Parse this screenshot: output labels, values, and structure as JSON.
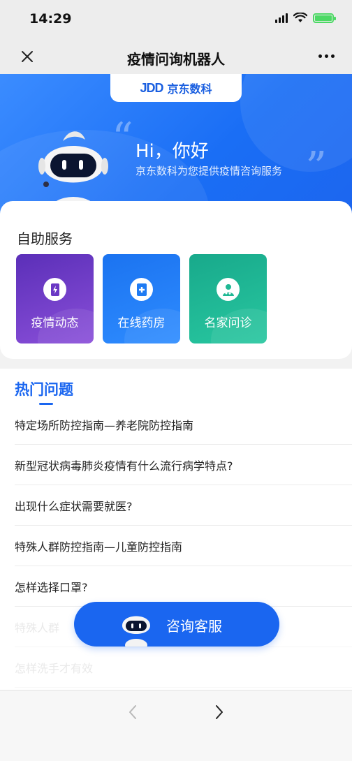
{
  "status_bar": {
    "time": "14:29"
  },
  "nav": {
    "title": "疫情问询机器人"
  },
  "hero": {
    "logo_mark": "JDD",
    "logo_text": "京东数科",
    "greeting": "Hi，你好",
    "subtitle": "京东数科为您提供疫情咨询服务"
  },
  "self_service": {
    "title": "自助服务",
    "tiles": [
      {
        "label": "疫情动态",
        "icon": "phone-bolt-icon"
      },
      {
        "label": "在线药房",
        "icon": "medical-plus-icon"
      },
      {
        "label": "名家问诊",
        "icon": "doctor-icon"
      }
    ]
  },
  "hot_questions": {
    "title": "热门问题",
    "items": [
      "特定场所防控指南—养老院防控指南",
      "新型冠状病毒肺炎疫情有什么流行病学特点?",
      "出现什么症状需要就医?",
      "特殊人群防控指南—儿童防控指南",
      "怎样选择口罩?",
      "特殊人群",
      "怎样洗手才有效"
    ]
  },
  "consult_button": {
    "label": "咨询客服"
  },
  "colors": {
    "accent": "#1a66f0",
    "tile_purple": "#6a38c4",
    "tile_blue": "#1f7bf3",
    "tile_green": "#1fb894",
    "battery": "#4cd964"
  }
}
